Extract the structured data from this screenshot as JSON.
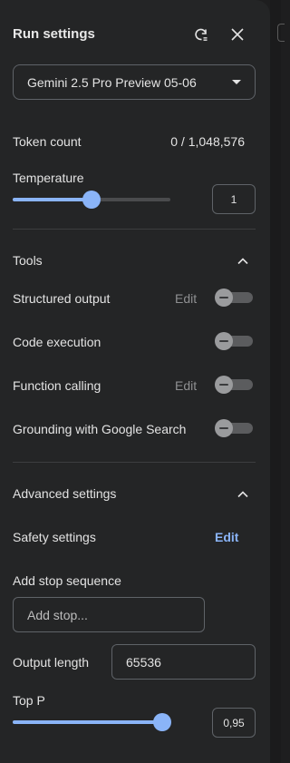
{
  "header": {
    "title": "Run settings",
    "reset_icon": "reset-icon",
    "close_icon": "close-icon"
  },
  "model": {
    "selected": "Gemini 2.5 Pro Preview 05-06"
  },
  "token_count": {
    "label": "Token count",
    "value": "0 / 1,048,576"
  },
  "temperature": {
    "label": "Temperature",
    "value": "1",
    "fraction": 0.5
  },
  "tools": {
    "heading": "Tools",
    "items": [
      {
        "label": "Structured output",
        "edit": "Edit",
        "enabled": false
      },
      {
        "label": "Code execution",
        "edit": "",
        "enabled": false
      },
      {
        "label": "Function calling",
        "edit": "Edit",
        "enabled": false
      },
      {
        "label": "Grounding with Google Search",
        "edit": "",
        "enabled": false
      }
    ]
  },
  "advanced": {
    "heading": "Advanced settings",
    "safety_label": "Safety settings",
    "safety_edit": "Edit",
    "stop_label": "Add stop sequence",
    "stop_placeholder": "Add stop...",
    "output_length_label": "Output length",
    "output_length_value": "65536",
    "top_p_label": "Top P",
    "top_p_value": "0,95",
    "top_p_fraction": 0.95
  },
  "colors": {
    "accent": "#8ab4f8",
    "panel": "#242526",
    "text": "#e3e3e3"
  }
}
